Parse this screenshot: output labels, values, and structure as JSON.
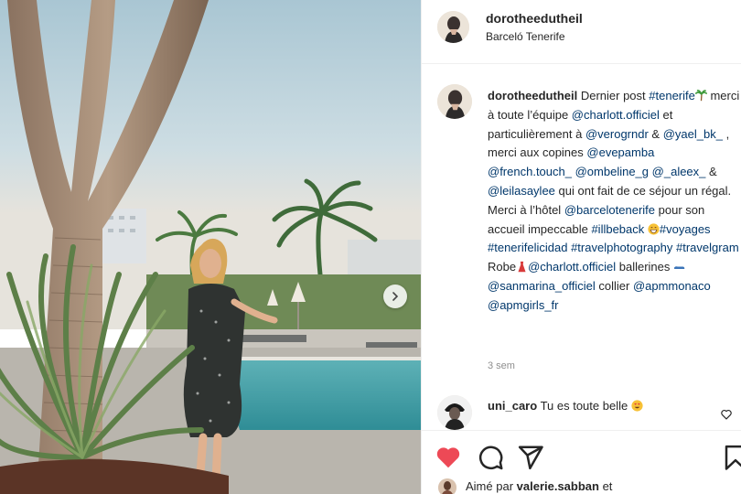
{
  "post": {
    "username": "dorotheedutheil",
    "location": "Barceló Tenerife"
  },
  "caption": {
    "username": "dorotheedutheil",
    "segments": [
      {
        "t": " Dernier post "
      },
      {
        "t": "#tenerife",
        "link": true
      },
      {
        "emoji": "palm-tree"
      },
      {
        "t": " merci à toute l’équipe "
      },
      {
        "t": "@charlott.officiel",
        "link": true
      },
      {
        "t": " et particulièrement à "
      },
      {
        "t": "@verogrndr",
        "link": true
      },
      {
        "t": " & "
      },
      {
        "t": "@yael_bk_",
        "link": true
      },
      {
        "t": " , merci aux copines "
      },
      {
        "t": "@evepamba",
        "link": true
      },
      {
        "t": " "
      },
      {
        "t": "@french.touch_",
        "link": true
      },
      {
        "t": " "
      },
      {
        "t": "@ombeline_g",
        "link": true
      },
      {
        "t": " "
      },
      {
        "t": "@_aleex_",
        "link": true
      },
      {
        "t": " & "
      },
      {
        "t": "@leilasaylee",
        "link": true
      },
      {
        "t": " qui ont fait de ce séjour un régal. Merci à l’hôtel "
      },
      {
        "t": "@barcelotenerife",
        "link": true
      },
      {
        "t": " pour son accueil impeccable "
      },
      {
        "t": "#illbeback",
        "link": true
      },
      {
        "t": " "
      },
      {
        "emoji": "grin"
      },
      {
        "t": "#voyages",
        "link": true
      },
      {
        "t": " "
      },
      {
        "t": "#tenerifelicidad",
        "link": true
      },
      {
        "t": " "
      },
      {
        "t": "#travelphotography",
        "link": true
      },
      {
        "t": " "
      },
      {
        "t": "#travelgram",
        "link": true
      },
      {
        "t": " Robe"
      },
      {
        "emoji": "dress"
      },
      {
        "t": "@charlott.officiel",
        "link": true
      },
      {
        "t": " ballerines "
      },
      {
        "emoji": "flat-shoe"
      },
      {
        "t": "  "
      },
      {
        "t": "@sanmarina_officiel",
        "link": true
      },
      {
        "t": " collier "
      },
      {
        "t": "@apmmonaco",
        "link": true
      },
      {
        "t": " "
      },
      {
        "t": "@apmgirls_fr",
        "link": true
      }
    ],
    "time_ago": "3 sem"
  },
  "comment": {
    "username": "uni_caro",
    "text": " Tu es toute belle",
    "emoji": "heart-eyes"
  },
  "likes": {
    "prefix": "Aimé par ",
    "username": "valerie.sabban",
    "suffix": " et"
  },
  "icons": {
    "like": "heart-icon",
    "comment": "comment-icon",
    "share": "share-icon",
    "save": "bookmark-icon",
    "carousel": "chevron-right-icon"
  },
  "colors": {
    "link": "#00376b",
    "like_red": "#ed4956",
    "muted": "#8e8e8e",
    "text": "#262626"
  }
}
